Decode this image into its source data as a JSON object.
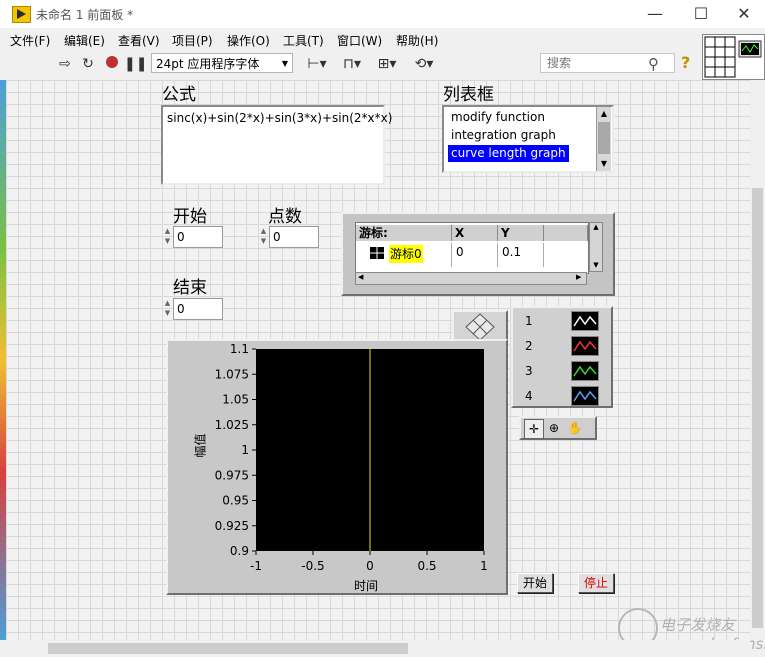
{
  "window": {
    "title": "未命名 1 前面板 *",
    "controls": {
      "minimize": "—",
      "maximize": "☐",
      "close": "✕"
    }
  },
  "menu": {
    "items": [
      "文件(F)",
      "编辑(E)",
      "查看(V)",
      "项目(P)",
      "操作(O)",
      "工具(T)",
      "窗口(W)",
      "帮助(H)"
    ]
  },
  "toolbar": {
    "font": "24pt 应用程序字体",
    "search_placeholder": "搜索",
    "help_icon": "?",
    "icons": [
      "run-arrow-icon",
      "run-continuous-icon",
      "abort-icon",
      "pause-icon",
      "align-icon",
      "distribute-icon",
      "resize-icon",
      "reorder-icon",
      "search-icon",
      "help-icon"
    ]
  },
  "formula": {
    "label": "公式",
    "value": "sinc(x)+sin(2*x)+sin(3*x)+sin(2*x*x)"
  },
  "listbox": {
    "label": "列表框",
    "items": [
      "modify function",
      "integration graph",
      "curve length graph"
    ],
    "selected_index": 2,
    "selection_color": "#0000ff"
  },
  "controls": {
    "start": {
      "label": "开始",
      "value": "0"
    },
    "points": {
      "label": "点数",
      "value": "0"
    },
    "end": {
      "label": "结束",
      "value": "0"
    }
  },
  "cursor_table": {
    "headers": [
      "游标:",
      "X",
      "Y"
    ],
    "row": {
      "name": "游标0",
      "x": "0",
      "y": "0.1"
    },
    "cursor_color": "#ffff00"
  },
  "graph": {
    "ylabel": "幅值",
    "xlabel": "时间",
    "plot_bg": "#000000",
    "cursor_line_color": "#e8e000"
  },
  "plot_legend": {
    "entries": [
      {
        "name": "1",
        "color": "#ffffff"
      },
      {
        "name": "2",
        "color": "#ff3030"
      },
      {
        "name": "3",
        "color": "#30e030"
      },
      {
        "name": "4",
        "color": "#60a0ff"
      }
    ]
  },
  "buttons": {
    "start": "开始",
    "stop": "停止",
    "stop_color": "#e00000"
  },
  "watermark": "电子发烧友 www.elecfans.com",
  "chart_data": {
    "type": "line",
    "xlabel": "时间",
    "ylabel": "幅值",
    "xlim": [
      -1,
      1
    ],
    "ylim": [
      0.9,
      1.1
    ],
    "x_ticks": [
      "-1",
      "-0.5",
      "0",
      "0.5",
      "1"
    ],
    "y_ticks": [
      "1.1",
      "1.075",
      "1.05",
      "1.025",
      "1",
      "0.975",
      "0.95",
      "0.925",
      "0.9"
    ],
    "cursor_x": 0,
    "series": []
  }
}
